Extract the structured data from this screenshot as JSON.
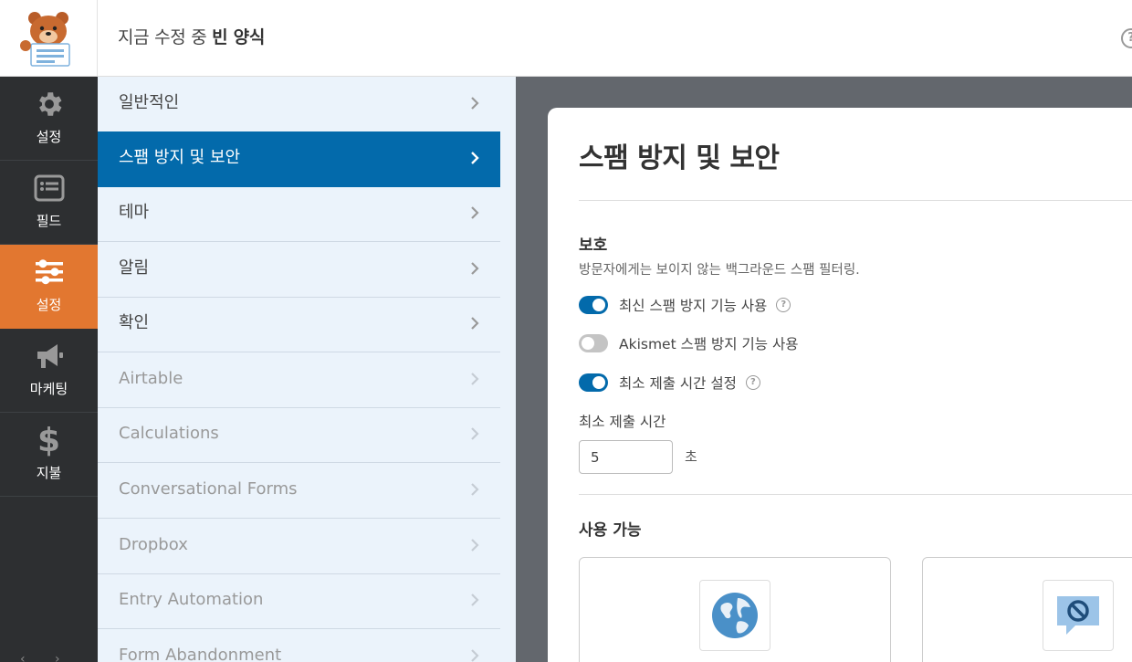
{
  "header": {
    "title_prefix": "지금 수정 중",
    "form_name": "빈 양식",
    "help_icon": "question-circle-icon"
  },
  "leftnav": {
    "items": [
      {
        "label": "설정",
        "icon": "gear-icon"
      },
      {
        "label": "필드",
        "icon": "list-icon"
      },
      {
        "label": "설정",
        "icon": "sliders-icon",
        "active": true
      },
      {
        "label": "마케팅",
        "icon": "megaphone-icon"
      },
      {
        "label": "지불",
        "icon": "dollar-icon"
      }
    ]
  },
  "submenu": {
    "items": [
      {
        "label": "일반적인"
      },
      {
        "label": "스팸 방지 및 보안",
        "active": true
      },
      {
        "label": "테마"
      },
      {
        "label": "알림"
      },
      {
        "label": "확인"
      },
      {
        "label": "Airtable",
        "muted": true
      },
      {
        "label": "Calculations",
        "muted": true
      },
      {
        "label": "Conversational Forms",
        "muted": true
      },
      {
        "label": "Dropbox",
        "muted": true
      },
      {
        "label": "Entry Automation",
        "muted": true
      },
      {
        "label": "Form Abandonment",
        "muted": true
      }
    ]
  },
  "panel": {
    "title": "스팸 방지 및 보안",
    "protection": {
      "heading": "보호",
      "description": "방문자에게는 보이지 않는 백그라운드 스팸 필터링.",
      "toggles": [
        {
          "label": "최신 스팸 방지 기능 사용",
          "on": true,
          "help": true
        },
        {
          "label": "Akismet 스팸 방지 기능 사용",
          "on": false,
          "help": false
        },
        {
          "label": "최소 제출 시간 설정",
          "on": true,
          "help": true
        }
      ],
      "min_time": {
        "label": "최소 제출 시간",
        "value": "5",
        "unit": "초"
      }
    },
    "available": {
      "heading": "사용 가능",
      "providers": [
        {
          "icon": "globe-icon"
        },
        {
          "icon": "blocked-chat-icon"
        }
      ]
    }
  },
  "colors": {
    "accent_blue": "#036aab",
    "accent_orange": "#e27730",
    "nav_dark": "#2d2f31",
    "submenu_bg": "#ebf3fb"
  }
}
